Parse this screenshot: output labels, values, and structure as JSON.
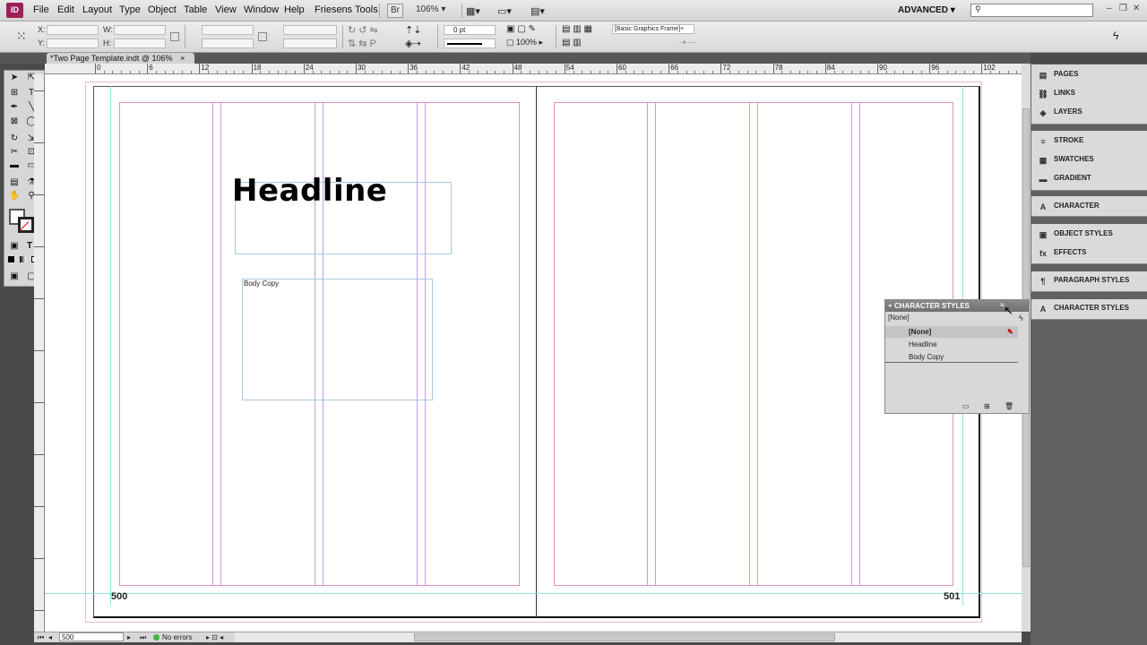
{
  "app": {
    "logo": "ID",
    "workspace": "ADVANCED"
  },
  "menu": [
    "File",
    "Edit",
    "Layout",
    "Type",
    "Object",
    "Table",
    "View",
    "Window",
    "Help",
    "Friesens Tools"
  ],
  "menubar": {
    "zoom": "106%",
    "br_label": "Br"
  },
  "control": {
    "x_label": "X:",
    "y_label": "Y:",
    "w_label": "W:",
    "h_label": "H:",
    "stroke_weight": "0 pt",
    "scale": "100%",
    "frame_style": "[Basic Graphics Frame]+"
  },
  "document": {
    "tab_title": "*Two Page Template.indt @ 106%",
    "close_glyph": "×"
  },
  "ruler": {
    "marks": [
      "0",
      "6",
      "12",
      "18",
      "24",
      "30",
      "36",
      "42",
      "48",
      "54",
      "60",
      "66",
      "72",
      "78",
      "84",
      "90",
      "96",
      "102"
    ]
  },
  "page": {
    "headline": "Headline",
    "body_copy_label": "Body Copy",
    "left_page_number": "500",
    "right_page_number": "501"
  },
  "status": {
    "page": "500",
    "errors": "No errors"
  },
  "dock": {
    "groups": [
      [
        "PAGES",
        "LINKS",
        "LAYERS"
      ],
      [
        "STROKE",
        "SWATCHES",
        "GRADIENT"
      ],
      [
        "CHARACTER"
      ],
      [
        "OBJECT STYLES",
        "EFFECTS"
      ],
      [
        "PARAGRAPH STYLES"
      ],
      [
        "CHARACTER STYLES"
      ]
    ],
    "icons": [
      [
        "pages-icon",
        "links-icon",
        "layers-icon"
      ],
      [
        "stroke-icon",
        "swatches-icon",
        "gradient-icon"
      ],
      [
        "character-icon"
      ],
      [
        "object-styles-icon",
        "effects-icon"
      ],
      [
        "paragraph-styles-icon"
      ],
      [
        "character-styles-icon"
      ]
    ]
  },
  "character_styles_panel": {
    "title": "CHARACTER STYLES",
    "current": "[None]",
    "items": [
      "[None]",
      "Headline",
      "Body Copy"
    ]
  }
}
